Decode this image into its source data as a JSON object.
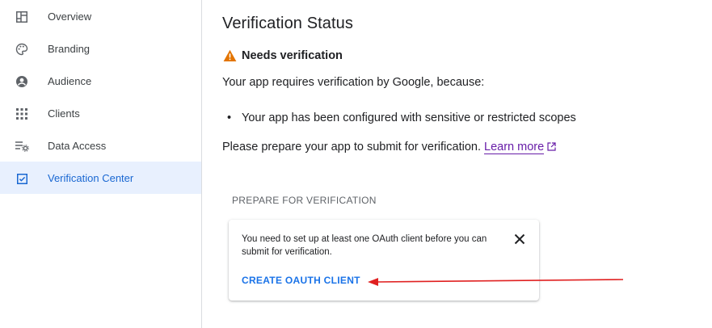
{
  "sidebar": {
    "items": [
      {
        "label": "Overview",
        "icon": "dashboard-icon"
      },
      {
        "label": "Branding",
        "icon": "palette-icon"
      },
      {
        "label": "Audience",
        "icon": "account-circle-icon"
      },
      {
        "label": "Clients",
        "icon": "apps-grid-icon"
      },
      {
        "label": "Data Access",
        "icon": "data-access-icon"
      },
      {
        "label": "Verification Center",
        "icon": "verification-icon",
        "active": true
      }
    ]
  },
  "main": {
    "title": "Verification Status",
    "status": "Needs verification",
    "intro": "Your app requires verification by Google, because:",
    "reasons": [
      "Your app has been configured with sensitive or restricted scopes"
    ],
    "prepare_text": "Please prepare your app to submit for verification.",
    "learn_more": "Learn more",
    "section_header": "PREPARE FOR VERIFICATION",
    "card": {
      "message": "You need to set up at least one OAuth client before you can submit for verification.",
      "action_label": "CREATE OAUTH CLIENT"
    }
  },
  "colors": {
    "accent": "#1a73e8",
    "active_bg": "#e8f0fe",
    "warning": "#e37400",
    "link_visited": "#681da8",
    "annotation_arrow": "#e02020"
  }
}
